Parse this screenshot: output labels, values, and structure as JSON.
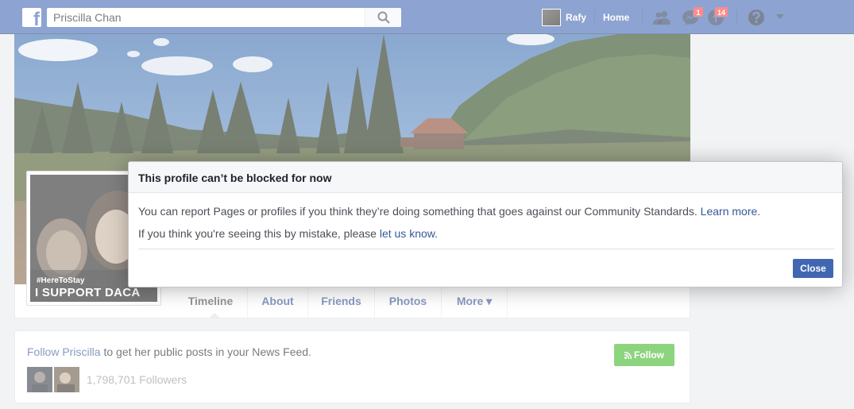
{
  "topbar": {
    "logo": "f",
    "search_value": "Priscilla Chan",
    "user_name": "Rafy",
    "home_label": "Home",
    "messages_badge": "1",
    "notifications_badge": "14"
  },
  "profile": {
    "picture_tag": "#HereToStay",
    "picture_slogan": "I SUPPORT DACA",
    "tabs": [
      {
        "label": "Timeline"
      },
      {
        "label": "About"
      },
      {
        "label": "Friends"
      },
      {
        "label": "Photos"
      },
      {
        "label": "More ▾"
      }
    ]
  },
  "follow_card": {
    "link_text": "Follow Priscilla",
    "rest_text": " to get her public posts in your News Feed.",
    "button_label": "Follow",
    "followers_count": "1,798,701 Followers"
  },
  "dialog": {
    "title": "This profile can’t be blocked for now",
    "line1_text": "You can report Pages or profiles if you think they’re doing something that goes against our Community Standards. ",
    "line1_link": "Learn more.",
    "line2_text": "If you think you're seeing this by mistake, please ",
    "line2_link": "let us know.",
    "close_label": "Close"
  },
  "colors": {
    "topbar": "#4267b2",
    "link": "#365899",
    "follow_button": "#42b72a",
    "badge": "#fa3e3e"
  }
}
